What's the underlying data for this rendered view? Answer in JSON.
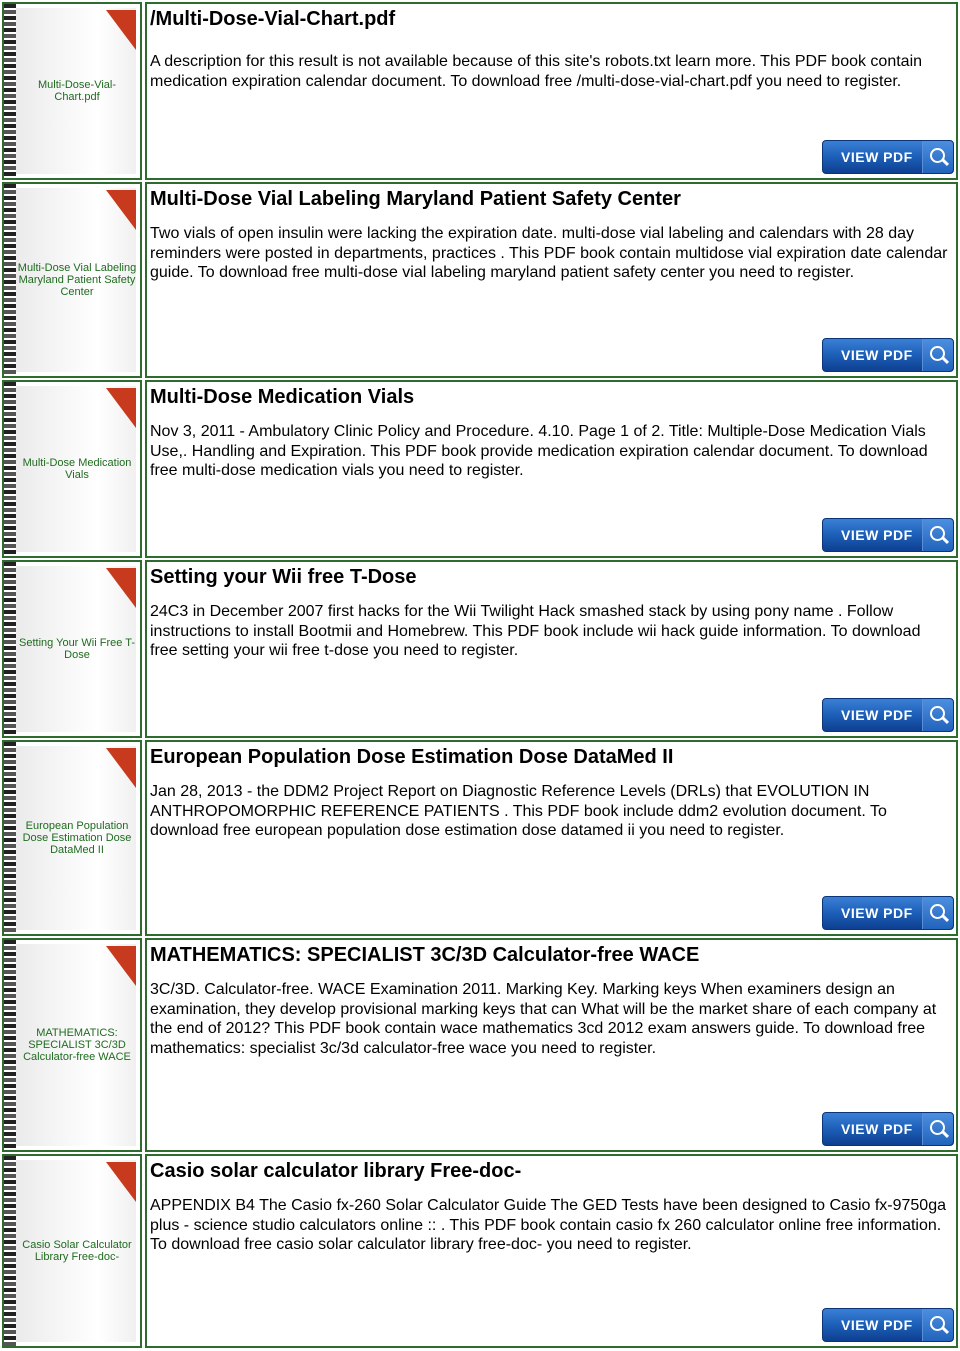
{
  "view_button_label": "VIEW PDF",
  "entries": [
    {
      "thumb_title": "Multi-Dose-Vial-Chart.pdf",
      "title": "/Multi-Dose-Vial-Chart.pdf",
      "description": "A description for this result is not available because of this site's robots.txt learn more. This PDF book contain medication expiration calendar document. To download free /multi-dose-vial-chart.pdf you need to register."
    },
    {
      "thumb_title": "Multi-Dose Vial Labeling Maryland Patient Safety Center",
      "title": "Multi-Dose Vial Labeling Maryland Patient Safety Center",
      "description": "Two vials of open insulin were lacking the expiration date. multi-dose vial labeling and calendars with 28 day reminders were posted in departments, practices . This PDF book contain multidose vial expiration date calendar guide. To download free multi-dose vial labeling maryland patient safety center you need to register."
    },
    {
      "thumb_title": "Multi-Dose Medication Vials",
      "title": "Multi-Dose Medication Vials",
      "description": "Nov 3, 2011 - Ambulatory Clinic Policy and Procedure. 4.10. Page 1 of 2. Title: Multiple-Dose Medication Vials Use,. Handling and Expiration. This PDF book provide medication expiration calendar document. To download free multi-dose medication vials you need to register."
    },
    {
      "thumb_title": "Setting Your Wii Free T-Dose",
      "title": "Setting your Wii free T-Dose",
      "description": "24C3 in December 2007 first hacks for the Wii Twilight Hack smashed stack by using pony name . Follow instructions to install Bootmii and Homebrew. This PDF book include wii hack guide information. To download free setting your wii free t-dose you need to register."
    },
    {
      "thumb_title": "European Population Dose Estimation Dose DataMed II",
      "title": "European Population Dose Estimation Dose DataMed II",
      "description": "Jan 28, 2013 - the DDM2 Project Report on Diagnostic Reference Levels (DRLs) that EVOLUTION IN ANTHROPOMORPHIC REFERENCE PATIENTS . This PDF book include ddm2 evolution document. To download free european population dose estimation dose datamed ii you need to register."
    },
    {
      "thumb_title": "MATHEMATICS: SPECIALIST 3C/3D Calculator-free WACE",
      "title": "MATHEMATICS: SPECIALIST 3C/3D Calculator-free WACE",
      "description": "3C/3D. Calculator-free. WACE Examination 2011. Marking Key. Marking keys When examiners design an examination, they develop provisional marking keys that can What will be the market share of each company at the end of 2012? This PDF book contain wace mathematics 3cd 2012 exam answers guide. To download free mathematics: specialist 3c/3d calculator-free wace you need to register."
    },
    {
      "thumb_title": "Casio Solar Calculator Library Free-doc-",
      "title": "Casio solar calculator library Free-doc-",
      "description": "APPENDIX B4 The Casio fx-260 Solar Calculator Guide The GED Tests have been designed to Casio fx-9750ga plus - science studio calculators online :: . This PDF book contain casio fx 260 calculator online free information. To download free casio solar calculator library free-doc- you need to register."
    }
  ]
}
